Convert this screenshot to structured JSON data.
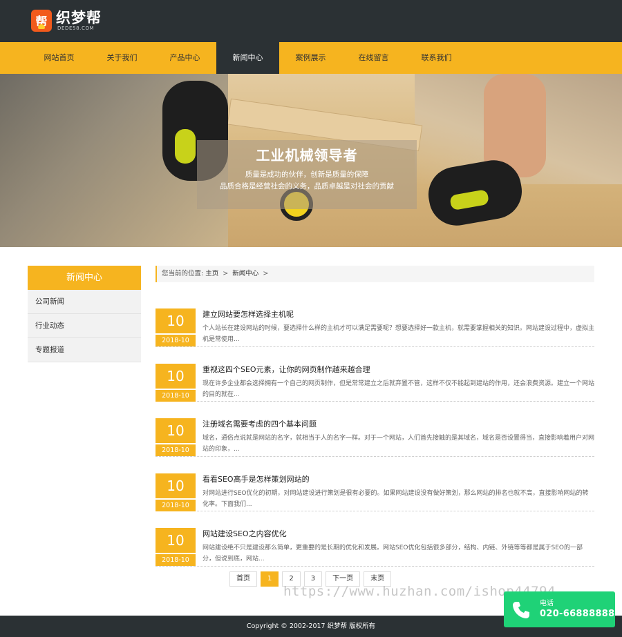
{
  "header": {
    "logo_name": "织梦帮",
    "logo_sub": "DEDE58.COM",
    "logo_glyph": "帮"
  },
  "nav": {
    "items": [
      "网站首页",
      "关于我们",
      "产品中心",
      "新闻中心",
      "案例展示",
      "在线留言",
      "联系我们"
    ],
    "active": "新闻中心"
  },
  "banner": {
    "title": "工业机械领导者",
    "line1": "质量是成功的伙伴，创新是质量的保障",
    "line2": "品质合格是经营社会的义务，品质卓越是对社会的贡献"
  },
  "sidebar": {
    "title": "新闻中心",
    "items": [
      "公司新闻",
      "行业动态",
      "专题报道"
    ]
  },
  "breadcrumb": {
    "prefix": "您当前的位置:",
    "home": "主页",
    "sep": ">",
    "current": "新闻中心",
    "tail": ">"
  },
  "news": [
    {
      "day": "10",
      "ym": "2018-10",
      "title": "建立网站要怎样选择主机呢",
      "desc": "个人站长在建设网站的时候，要选择什么样的主机才可以满足需要呢？想要选择好一款主机，就需要掌握相关的知识。网站建设过程中，虚拟主机是常使用..."
    },
    {
      "day": "10",
      "ym": "2018-10",
      "title": "重视这四个SEO元素，让你的网页制作越来越合理",
      "desc": "现在许多企业都会选择拥有一个自己的网页制作，但是常常建立之后就弃置不管，这样不仅不能起到建站的作用，还会浪费资源。建立一个网站的目的就在..."
    },
    {
      "day": "10",
      "ym": "2018-10",
      "title": "注册域名需要考虑的四个基本问题",
      "desc": "域名，通俗点说就是网站的名字，就相当于人的名字一样。对于一个网站，人们首先接触的是其域名，域名是否设置得当，直接影响着用户对网站的印象，..."
    },
    {
      "day": "10",
      "ym": "2018-10",
      "title": "看看SEO高手是怎样策划网站的",
      "desc": "对网站进行SEO优化的初期，对网站建设进行策划是很有必要的。如果网站建设没有做好策划，那么网站的排名也就不高，直接影响网站的转化率。下面我们..."
    },
    {
      "day": "10",
      "ym": "2018-10",
      "title": "网站建设SEO之内容优化",
      "desc": "网站建设绝不只是建设那么简单，更重要的是长期的优化和发展。网站SEO优化包括很多部分，结构、内链、外链等等都是属于SEO的一部分，但说到底，网站..."
    }
  ],
  "pager": {
    "first": "首页",
    "pages": [
      "1",
      "2",
      "3"
    ],
    "current": "1",
    "next": "下一页",
    "last": "末页"
  },
  "watermark": "https://www.huzhan.com/ishop44794",
  "footer": {
    "copyright": "Copyright © 2002-2017 织梦帮 版权所有"
  },
  "phone": {
    "label": "电话",
    "number": "020-66888888"
  },
  "colors": {
    "accent": "#f6b41f",
    "dark": "#2b3134",
    "phone": "#1fd277"
  }
}
